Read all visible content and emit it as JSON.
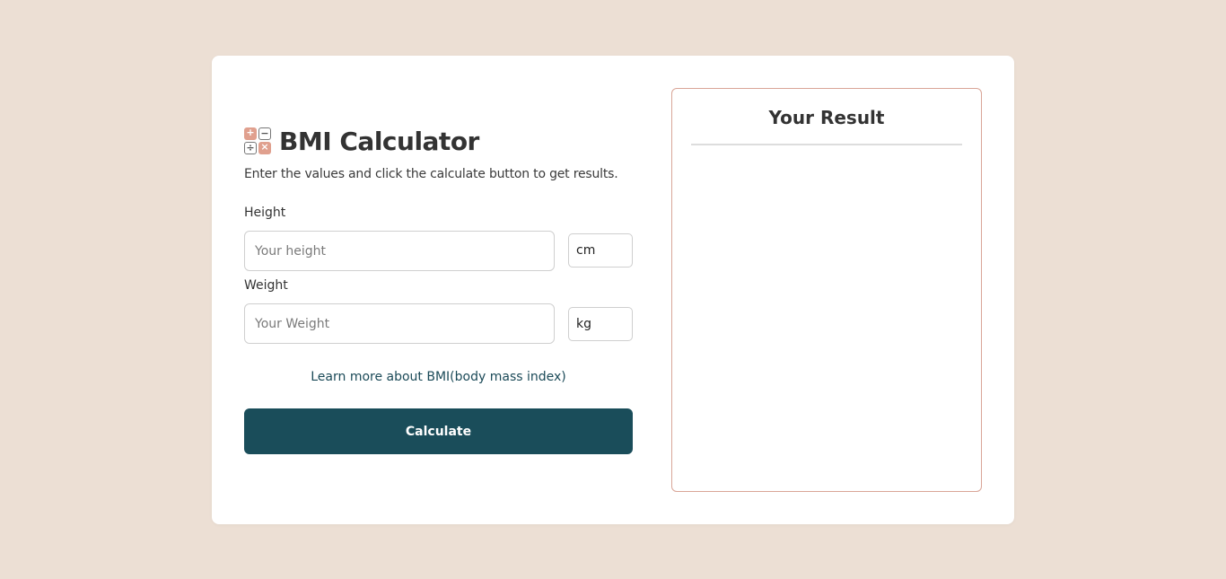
{
  "app": {
    "title": "BMI Calculator",
    "subtitle": "Enter the values and click the calculate button to get results."
  },
  "logo": {
    "cells": [
      "+",
      "−",
      "÷",
      "×"
    ]
  },
  "form": {
    "height": {
      "label": "Height",
      "placeholder": "Your height",
      "value": "",
      "unit": "cm"
    },
    "weight": {
      "label": "Weight",
      "placeholder": "Your Weight",
      "value": "",
      "unit": "kg"
    },
    "learn_more_link": "Learn more about BMI(body mass index)",
    "calculate_label": "Calculate"
  },
  "result": {
    "title": "Your Result"
  },
  "colors": {
    "background": "#ecdfd4",
    "card": "#ffffff",
    "primary": "#1a4d5a",
    "accent": "#e0a08e",
    "result_border": "#d9a597"
  }
}
